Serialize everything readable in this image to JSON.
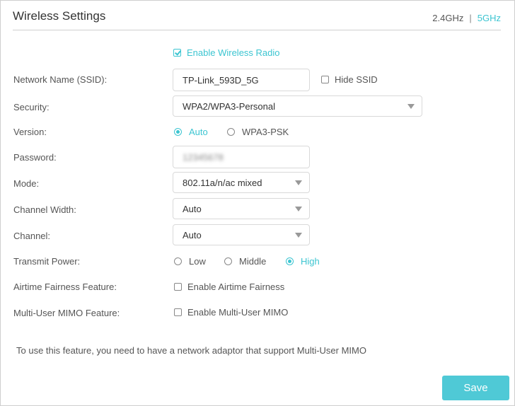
{
  "header": {
    "title": "Wireless Settings",
    "band_24": "2.4GHz",
    "band_separator": "|",
    "band_5": "5GHz",
    "active_band": "5GHz"
  },
  "enable_radio": {
    "label": "Enable Wireless Radio",
    "checked": true
  },
  "ssid": {
    "label": "Network Name (SSID):",
    "value": "TP-Link_593D_5G",
    "hide_label": "Hide SSID",
    "hide_checked": false
  },
  "security": {
    "label": "Security:",
    "value": "WPA2/WPA3-Personal"
  },
  "version": {
    "label": "Version:",
    "options": [
      "Auto",
      "WPA3-PSK"
    ],
    "selected": "Auto"
  },
  "password": {
    "label": "Password:",
    "value": "12345678"
  },
  "mode": {
    "label": "Mode:",
    "value": "802.11a/n/ac mixed"
  },
  "channel_width": {
    "label": "Channel Width:",
    "value": "Auto"
  },
  "channel": {
    "label": "Channel:",
    "value": "Auto"
  },
  "transmit_power": {
    "label": "Transmit Power:",
    "options": [
      "Low",
      "Middle",
      "High"
    ],
    "selected": "High"
  },
  "airtime": {
    "label": "Airtime Fairness Feature:",
    "checkbox_label": "Enable Airtime Fairness",
    "checked": false
  },
  "mumimo": {
    "label": "Multi-User MIMO Feature:",
    "checkbox_label": "Enable Multi-User MIMO",
    "checked": false
  },
  "note": "To use this feature, you need to have a network adaptor that support Multi-User MIMO",
  "save_label": "Save",
  "colors": {
    "accent": "#3cc5d1",
    "button": "#4fc9d6",
    "border": "#d9d9d9"
  }
}
